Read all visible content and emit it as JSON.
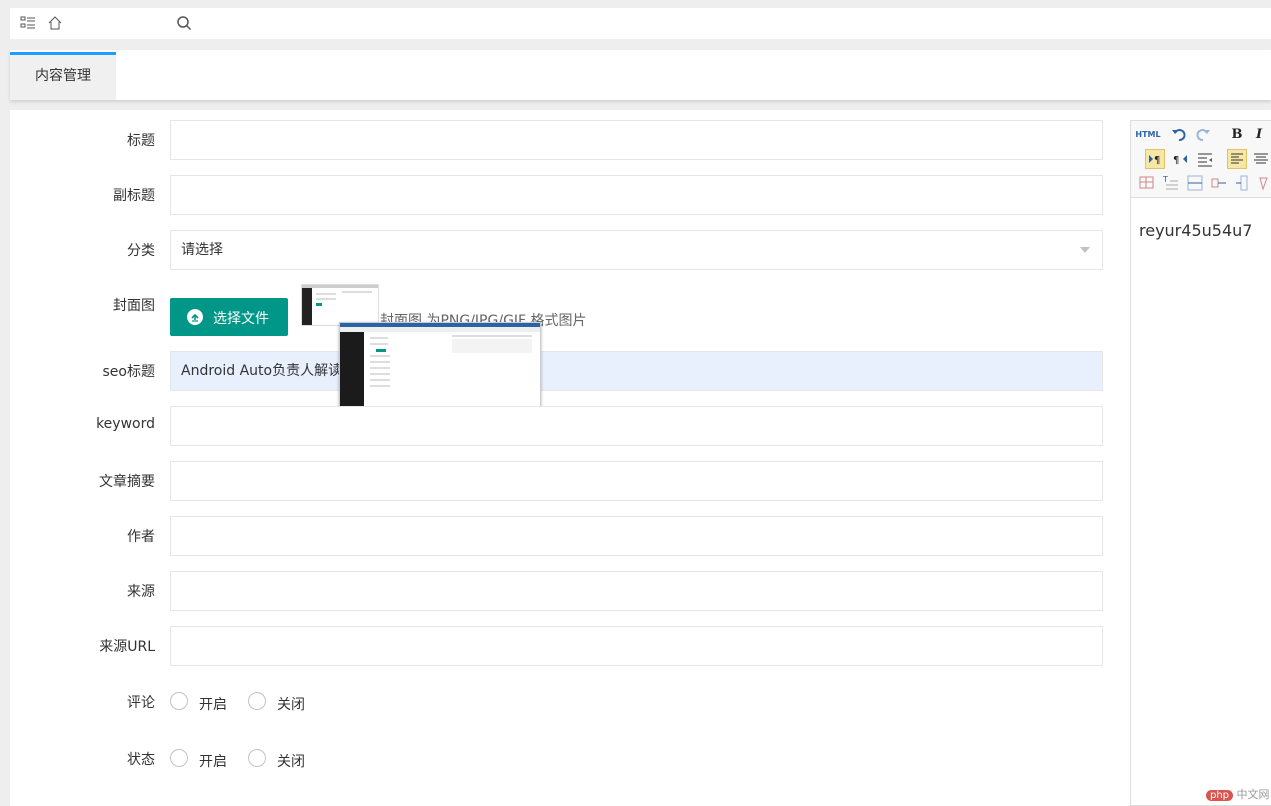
{
  "tabs": [
    {
      "label": "内容管理"
    }
  ],
  "form": {
    "title_label": "标题",
    "subtitle_label": "副标题",
    "category_label": "分类",
    "category_value": "请选择",
    "cover_label": "封面图",
    "upload_button": "选择文件",
    "cover_hint": "封面图 为PNG/JPG/GIF 格式图片",
    "seo_title_label": "seo标题",
    "seo_title_value": "Android Auto负责人解读谷",
    "keyword_label": "keyword",
    "summary_label": "文章摘要",
    "author_label": "作者",
    "source_label": "来源",
    "source_url_label": "来源URL",
    "comment_label": "评论",
    "status_label": "状态",
    "radio_on": "开启",
    "radio_off": "关闭"
  },
  "editor": {
    "toolbar": [
      "HTML",
      "undo",
      "redo",
      "bold",
      "italic",
      "ltr",
      "rtl",
      "indent",
      "align-left",
      "align-center"
    ],
    "content": "reyur45u54u7"
  },
  "watermark": {
    "logo": "php",
    "text": "中文网"
  },
  "colors": {
    "accent": "#009688",
    "tab_indicator": "#1e9fff",
    "highlight": "#e8f0fe"
  }
}
